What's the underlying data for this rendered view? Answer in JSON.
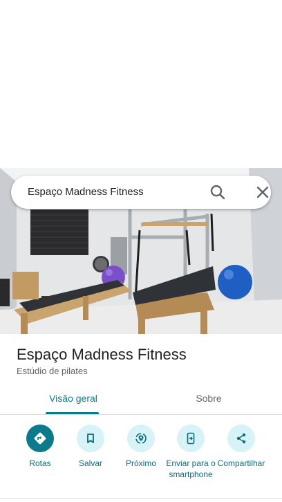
{
  "search": {
    "query": "Espaço Madness Fitness"
  },
  "place": {
    "name": "Espaço Madness Fitness",
    "category": "Estúdio de pilates"
  },
  "tabs": [
    {
      "label": "Visão geral",
      "selected": true
    },
    {
      "label": "Sobre",
      "selected": false
    }
  ],
  "actions": [
    {
      "label": "Rotas",
      "icon": "directions-icon"
    },
    {
      "label": "Salvar",
      "icon": "bookmark-icon"
    },
    {
      "label": "Próximo",
      "icon": "nearby-icon"
    },
    {
      "label": "Enviar para o smartphone",
      "icon": "send-to-phone-icon"
    },
    {
      "label": "Compartilhar",
      "icon": "share-icon"
    }
  ],
  "colors": {
    "accent": "#0b7a8a",
    "action_bg": "#d8f3f7",
    "text_primary": "#202124",
    "text_secondary": "#5f6368"
  }
}
